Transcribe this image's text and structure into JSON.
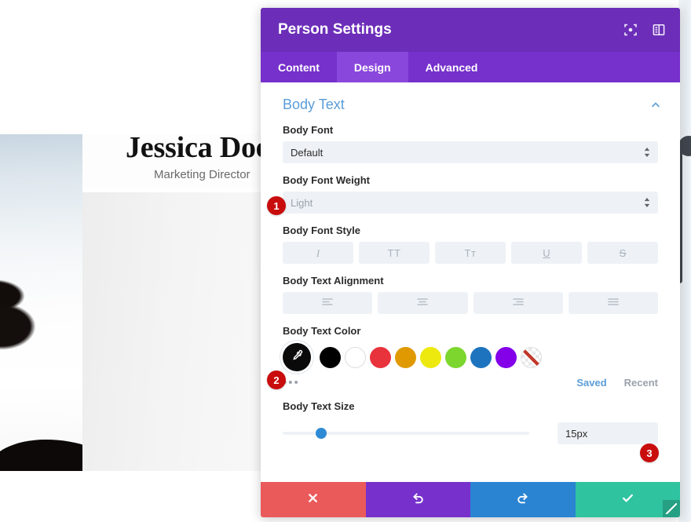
{
  "background": {
    "person_name": "Jessica Doe",
    "person_role": "Marketing Director"
  },
  "modal": {
    "header": {
      "title": "Person Settings",
      "icons": [
        {
          "name": "fullscreen-icon",
          "label": "fullscreen"
        },
        {
          "name": "layout-panel-icon",
          "label": "layout"
        }
      ]
    },
    "tabs": [
      {
        "label": "Content",
        "active": false
      },
      {
        "label": "Design",
        "active": true
      },
      {
        "label": "Advanced",
        "active": false
      }
    ],
    "section": {
      "title": "Body Text",
      "collapse_icon": "chevron-up-icon"
    },
    "fields": {
      "body_font": {
        "label": "Body Font",
        "value": "Default"
      },
      "body_font_weight": {
        "label": "Body Font Weight",
        "value": "Light"
      },
      "body_font_style": {
        "label": "Body Font Style",
        "options": [
          {
            "name": "italic",
            "glyph": "I"
          },
          {
            "name": "uppercase",
            "glyph": "TT"
          },
          {
            "name": "small-caps",
            "glyph": "Tт"
          },
          {
            "name": "underline",
            "glyph": "U"
          },
          {
            "name": "strikethrough",
            "glyph": "S"
          }
        ]
      },
      "body_text_alignment": {
        "label": "Body Text Alignment",
        "options": [
          {
            "name": "align-left"
          },
          {
            "name": "align-center"
          },
          {
            "name": "align-right"
          },
          {
            "name": "align-justify"
          }
        ]
      },
      "body_text_color": {
        "label": "Body Text Color",
        "picker_icon": "eyedropper-icon",
        "swatches": [
          {
            "name": "black",
            "hex": "#000000"
          },
          {
            "name": "white",
            "hex": "#ffffff"
          },
          {
            "name": "red",
            "hex": "#e8323c"
          },
          {
            "name": "orange",
            "hex": "#e09900"
          },
          {
            "name": "yellow",
            "hex": "#ede90e"
          },
          {
            "name": "green",
            "hex": "#7cd62e"
          },
          {
            "name": "blue",
            "hex": "#1e73be"
          },
          {
            "name": "purple",
            "hex": "#8300e9"
          },
          {
            "name": "transparent",
            "hex": "none"
          }
        ],
        "more_label": "•••",
        "saved_label": "Saved",
        "recent_label": "Recent"
      },
      "body_text_size": {
        "label": "Body Text Size",
        "value": "15px",
        "slider_percent": 15.5
      }
    },
    "footer": {
      "buttons": [
        {
          "name": "cancel-button",
          "glyph": "✖",
          "color": "#eb5a5a"
        },
        {
          "name": "undo-button",
          "glyph": "↺",
          "color": "#7730cc"
        },
        {
          "name": "redo-button",
          "glyph": "↻",
          "color": "#2a84d2"
        },
        {
          "name": "save-button",
          "glyph": "✔",
          "color": "#2fc3a0"
        }
      ]
    }
  },
  "annotations": {
    "badge_1": "1",
    "badge_2": "2",
    "badge_3": "3"
  },
  "colors": {
    "header_purple": "#6c2eb9",
    "tabs_purple": "#7630cc",
    "tab_active": "#8a47dc",
    "section_blue": "#5b9dd9",
    "badge_red": "#c90d0d"
  }
}
